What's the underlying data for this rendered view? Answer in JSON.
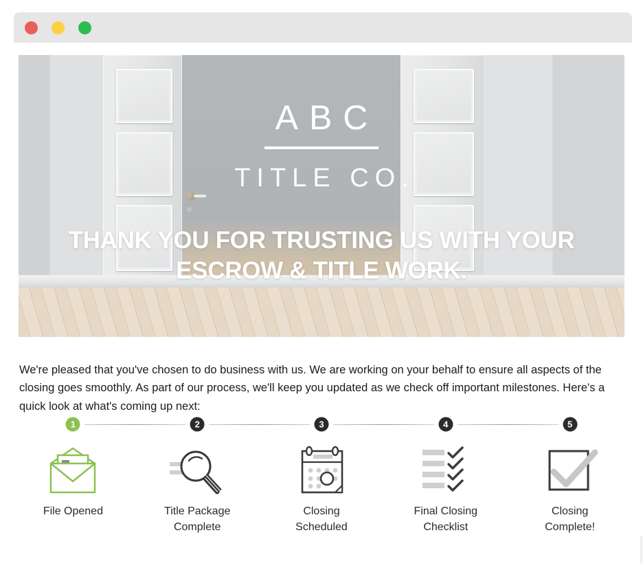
{
  "window": {
    "traffic_lights": [
      {
        "name": "close",
        "color": "#e85f5c"
      },
      {
        "name": "minimize",
        "color": "#fcd043"
      },
      {
        "name": "zoom",
        "color": "#2bbd4e"
      }
    ]
  },
  "hero": {
    "logo_primary": "ABC",
    "logo_secondary": "TITLE CO.",
    "headline": "THANK YOU FOR TRUSTING US WITH YOUR ESCROW & TITLE WORK.",
    "alt": "Open white paneled double doors on light wood floor"
  },
  "body": {
    "paragraph": "We're pleased that you've chosen to do business with us. We are working on your behalf to ensure all aspects of the closing goes smoothly. As part of our process, we'll keep you updated as we check off important milestones. Here's a quick look at what's coming up next:"
  },
  "colors": {
    "active_green": "#8cc152",
    "step_dark": "#2b2b2b",
    "text_dark": "#1b1b1b",
    "titlebar": "#e6e6e6"
  },
  "stepper": {
    "steps": [
      {
        "number": "1",
        "label": "File Opened",
        "icon": "open-envelope-icon",
        "state": "active"
      },
      {
        "number": "2",
        "label": "Title Package\nComplete",
        "icon": "magnifying-glass-icon",
        "state": "upcoming"
      },
      {
        "number": "3",
        "label": "Closing\nScheduled",
        "icon": "calendar-icon",
        "state": "upcoming"
      },
      {
        "number": "4",
        "label": "Final Closing\nChecklist",
        "icon": "checklist-icon",
        "state": "upcoming"
      },
      {
        "number": "5",
        "label": "Closing\nComplete!",
        "icon": "checked-box-icon",
        "state": "upcoming"
      }
    ]
  }
}
